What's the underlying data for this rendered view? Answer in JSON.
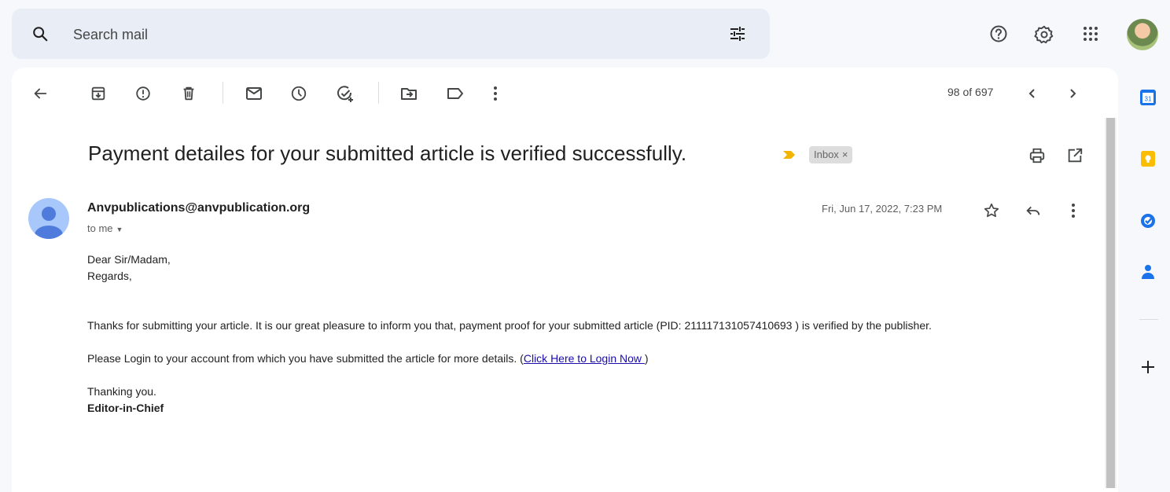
{
  "search": {
    "placeholder": "Search mail"
  },
  "toolbar": {
    "count": "98 of 697"
  },
  "email": {
    "subject": "Payment detailes for your submitted article is verified successfully.",
    "label": "Inbox",
    "label_close": "×",
    "sender": "Anvpublications@anvpublication.org",
    "recipient": "to me",
    "date": "Fri, Jun 17, 2022, 7:23 PM",
    "body": {
      "greeting": "Dear Sir/Madam,",
      "regards": "Regards,",
      "paragraph1": "Thanks for submitting your article. It is our great pleasure to inform you that, payment proof for your submitted article (PID: 211117131057410693 ) is verified by the publisher.",
      "paragraph2_prefix": "Please Login to your account from which you have submitted the article for more details. (",
      "paragraph2_link": "Click Here to Login Now ",
      "paragraph2_suffix": ")",
      "closing": "Thanking you.",
      "signature": "Editor-in-Chief"
    }
  },
  "side_panel": {
    "calendar_day": "31"
  },
  "colors": {
    "background": "#f6f8fc",
    "search_bg": "#e9eef6",
    "important_marker": "#f2b600",
    "link": "#1a0dab",
    "calendar_blue": "#1a73e8",
    "keep_yellow": "#fbbc04",
    "tasks_blue": "#1a73e8",
    "contacts_blue": "#1a73e8"
  },
  "icons": [
    "search-icon",
    "tune-icon",
    "help-icon",
    "settings-icon",
    "apps-icon",
    "back-icon",
    "archive-icon",
    "report-spam-icon",
    "delete-icon",
    "mark-unread-icon",
    "snooze-icon",
    "add-task-icon",
    "move-to-icon",
    "label-icon",
    "more-vert-icon",
    "chevron-left-icon",
    "chevron-right-icon",
    "print-icon",
    "open-new-window-icon",
    "star-icon",
    "reply-icon",
    "calendar-icon",
    "keep-icon",
    "tasks-icon",
    "contacts-icon",
    "add-icon"
  ]
}
